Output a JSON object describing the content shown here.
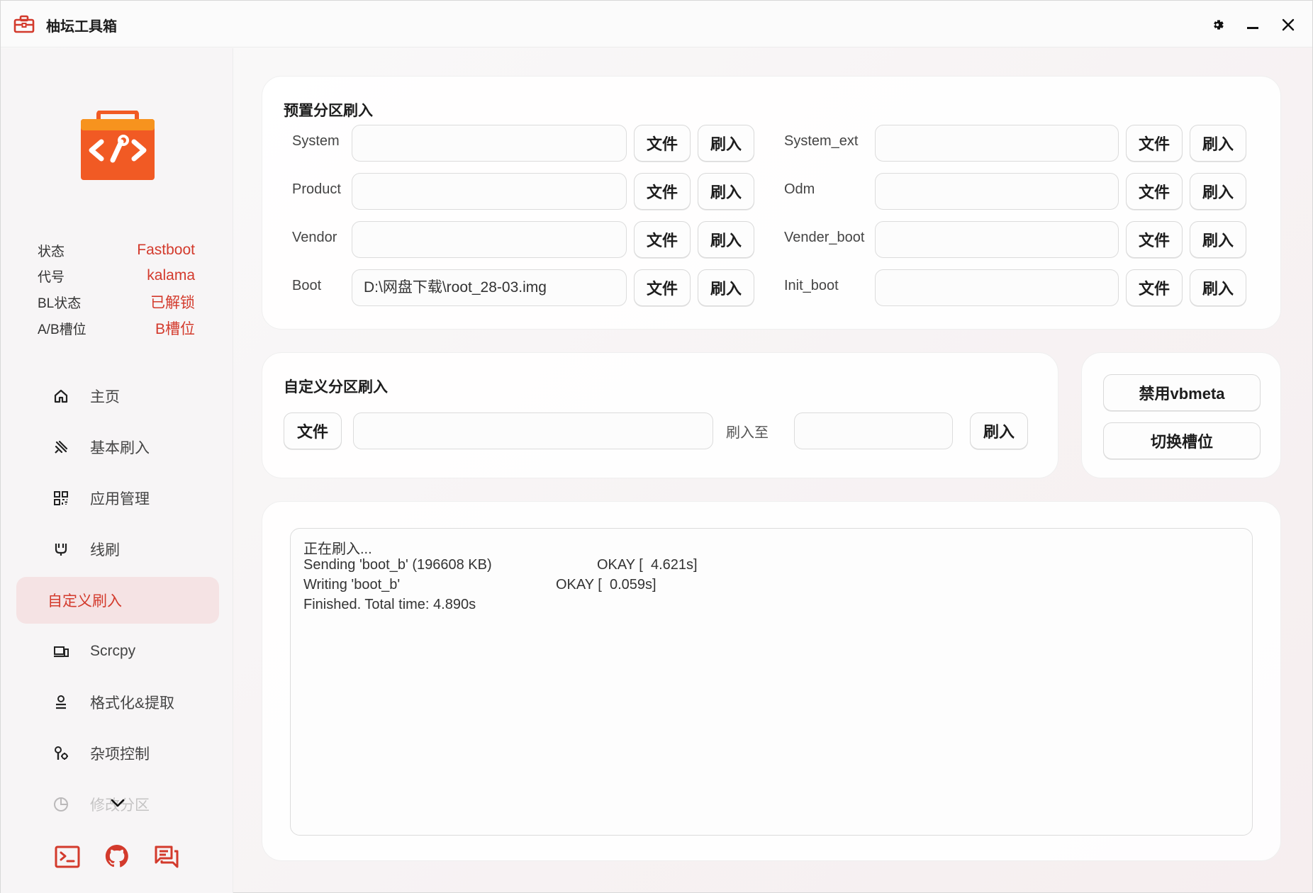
{
  "app": {
    "title": "柚坛工具箱"
  },
  "colors": {
    "accent": "#d33a2c",
    "logo_orange": "#f15a24",
    "logo_top": "#f7931e"
  },
  "status": [
    {
      "label": "状态",
      "value": "Fastboot"
    },
    {
      "label": "代号",
      "value": "kalama"
    },
    {
      "label": "BL状态",
      "value": "已解锁"
    },
    {
      "label": "A/B槽位",
      "value": "B槽位"
    }
  ],
  "nav": [
    {
      "label": "主页",
      "icon": "home-icon"
    },
    {
      "label": "基本刷入",
      "icon": "flash-icon"
    },
    {
      "label": "应用管理",
      "icon": "apps-icon"
    },
    {
      "label": "线刷",
      "icon": "cable-icon"
    },
    {
      "label": "自定义刷入",
      "icon": "custom-flash-icon",
      "active": true
    },
    {
      "label": "Scrcpy",
      "icon": "devices-icon"
    },
    {
      "label": "格式化&提取",
      "icon": "person-icon"
    },
    {
      "label": "杂项控制",
      "icon": "wrench-gear-icon"
    },
    {
      "label": "修改分区",
      "icon": "pie-icon"
    }
  ],
  "preset": {
    "title": "预置分区刷入",
    "file_label": "文件",
    "flash_label": "刷入",
    "left": [
      {
        "name": "System",
        "value": ""
      },
      {
        "name": "Product",
        "value": ""
      },
      {
        "name": "Vendor",
        "value": ""
      },
      {
        "name": "Boot",
        "value": "D:\\网盘下载\\root_28-03.img"
      }
    ],
    "right": [
      {
        "name": "System_ext",
        "value": ""
      },
      {
        "name": "Odm",
        "value": ""
      },
      {
        "name": "Vender_boot",
        "value": ""
      },
      {
        "name": "Init_boot",
        "value": ""
      }
    ]
  },
  "custom": {
    "title": "自定义分区刷入",
    "file_label": "文件",
    "file_path": "",
    "to_label": "刷入至",
    "partition": "",
    "flash_label": "刷入"
  },
  "actions": {
    "disable_vbmeta": "禁用vbmeta",
    "switch_slot": "切换槽位"
  },
  "log": {
    "lines": [
      {
        "text": "正在刷入...",
        "ok": ""
      },
      {
        "text": "Sending 'boot_b' (196608 KB)",
        "ok": "OKAY [  4.621s]"
      },
      {
        "text": "Writing 'boot_b'",
        "ok": "OKAY [  0.059s]"
      },
      {
        "text": "Finished. Total time: 4.890s",
        "ok": ""
      }
    ]
  }
}
